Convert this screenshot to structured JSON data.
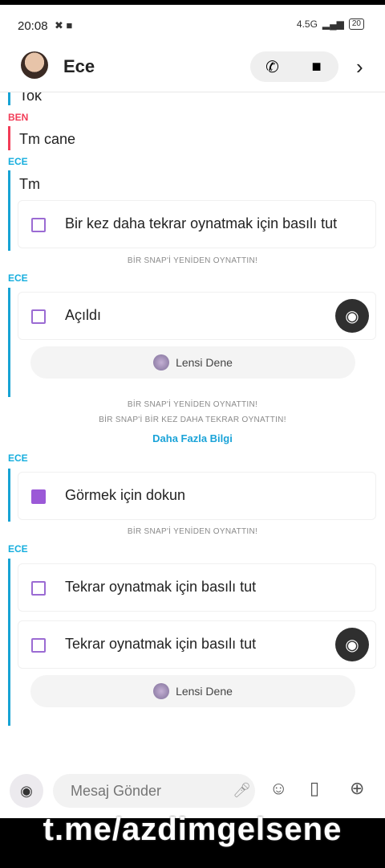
{
  "status": {
    "time": "20:08",
    "left_icons": "✖ ■",
    "network": "4.5G",
    "battery": "20"
  },
  "header": {
    "contact": "Ece"
  },
  "chat": {
    "snippet_top": "Tok",
    "label_ben": "BEN",
    "msg_ben": "Tm cane",
    "label_ece_1": "ECE",
    "msg_ece_1": "Tm",
    "snap1": "Bir kez daha tekrar oynatmak için basılı tut",
    "sys1": "BİR SNAP'İ YENİDEN OYNATTIN!",
    "label_ece_2": "ECE",
    "snap2": "Açıldı",
    "lens1": "Lensi Dene",
    "sys2": "BİR SNAP'İ YENİDEN OYNATTIN!",
    "sys3": "BİR SNAP'İ BİR KEZ DAHA TEKRAR OYNATTIN!",
    "more": "Daha Fazla Bilgi",
    "label_ece_3": "ECE",
    "snap3": "Görmek için dokun",
    "sys4": "BİR SNAP'İ YENİDEN OYNATTIN!",
    "label_ece_4": "ECE",
    "snap4": "Tekrar oynatmak için basılı tut",
    "snap5": "Tekrar oynatmak için basılı tut",
    "lens2": "Lensi Dene"
  },
  "input": {
    "placeholder": "Mesaj Gönder"
  },
  "watermark": "t.me/azdimgelsene",
  "colors": {
    "accent_cyan": "#15aede",
    "accent_pink": "#f23c57",
    "snap_purple": "#9b59d7"
  }
}
